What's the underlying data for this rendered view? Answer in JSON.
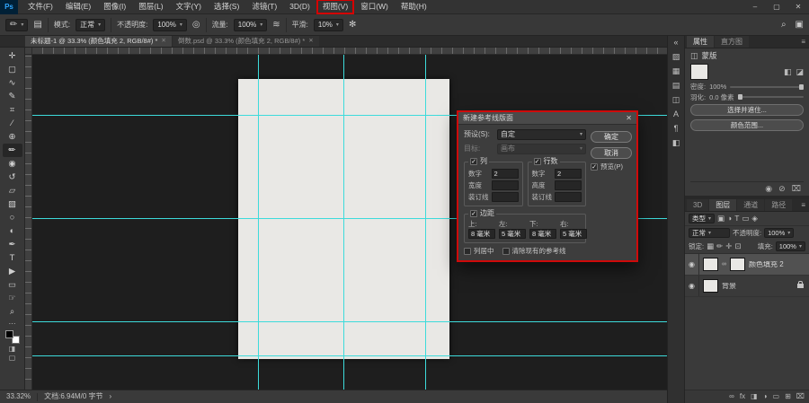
{
  "colors": {
    "annotation_red": "#d40000",
    "guide_cyan": "#3ddbdb",
    "ps_blue": "#31a8ff"
  },
  "icons": {
    "close": "✕",
    "minimize": "–",
    "maximize": "▢",
    "caret": "▾",
    "panel_menu": "≡",
    "collapse": "«",
    "search": "⌕",
    "workspace": "▣",
    "gear": "✻",
    "pressure": "◎",
    "airbrush": "≋",
    "brush_preset": "✏",
    "toggle_panel": "▤",
    "chevron": "›",
    "ellipsis": "⋯",
    "quick_mask": "◨",
    "screen_mode": "▢",
    "eye": "◉",
    "link": "∞",
    "fx": "fx",
    "add_mask": "◨",
    "adjustment": "◑",
    "group": "▭",
    "new_layer": "⊞",
    "trash": "⌧",
    "f_pixel": "▣",
    "f_adjust": "◑",
    "f_type": "T",
    "f_shape": "▭",
    "f_smart": "◈",
    "toggle": "●",
    "l_transparent": "▦",
    "l_brush": "✏",
    "l_move": "✛",
    "l_board": "⊡",
    "pixel_mask": "◧",
    "vector_mask": "◪",
    "invert": "⊘",
    "mask_head": "◫"
  },
  "titlebar": {
    "logo": "Ps",
    "menus": [
      "文件(F)",
      "编辑(E)",
      "图像(I)",
      "图层(L)",
      "文字(Y)",
      "选择(S)",
      "滤镜(T)",
      "3D(D)",
      "视图(V)",
      "窗口(W)",
      "帮助(H)"
    ],
    "highlighted_menu": "视图(V)"
  },
  "optionsbar": {
    "mode_label": "模式:",
    "mode_value": "正常",
    "opacity_label": "不透明度:",
    "opacity_value": "100%",
    "flow_label": "流量:",
    "flow_value": "100%",
    "smoothing_label": "平滑:",
    "smoothing_value": "10%"
  },
  "tabs": [
    {
      "label": "未标题-1 @ 33.3% (颜色填充 2, RGB/8#) *",
      "active": true
    },
    {
      "label": "倒数.psd @ 33.3% (颜色填充 2, RGB/8#) *",
      "active": false
    }
  ],
  "tools": [
    {
      "name": "move",
      "glyph": "✛"
    },
    {
      "name": "marquee",
      "glyph": "▢"
    },
    {
      "name": "lasso",
      "glyph": "∿"
    },
    {
      "name": "quick-select",
      "glyph": "✎"
    },
    {
      "name": "crop",
      "glyph": "⌗"
    },
    {
      "name": "eyedropper",
      "glyph": "∕"
    },
    {
      "name": "healing",
      "glyph": "⊕"
    },
    {
      "name": "brush",
      "glyph": "✏"
    },
    {
      "name": "clone-stamp",
      "glyph": "◉"
    },
    {
      "name": "history-brush",
      "glyph": "↺"
    },
    {
      "name": "eraser",
      "glyph": "▱"
    },
    {
      "name": "gradient",
      "glyph": "▧"
    },
    {
      "name": "blur",
      "glyph": "○"
    },
    {
      "name": "dodge",
      "glyph": "◐"
    },
    {
      "name": "pen",
      "glyph": "✒"
    },
    {
      "name": "type",
      "glyph": "T"
    },
    {
      "name": "path-select",
      "glyph": "▶"
    },
    {
      "name": "shape",
      "glyph": "▭"
    },
    {
      "name": "hand",
      "glyph": "☞"
    },
    {
      "name": "zoom",
      "glyph": "⌕"
    }
  ],
  "dock_icons": [
    {
      "name": "color",
      "glyph": "▨"
    },
    {
      "name": "swatches",
      "glyph": "▦"
    },
    {
      "name": "gradients",
      "glyph": "▤"
    },
    {
      "name": "patterns",
      "glyph": "◫"
    },
    {
      "name": "character",
      "glyph": "A"
    },
    {
      "name": "paragraph",
      "glyph": "¶"
    },
    {
      "name": "libraries",
      "glyph": "◧"
    }
  ],
  "dialog": {
    "title": "新建参考线版面",
    "preset_label": "预设(S):",
    "preset_value": "自定",
    "target_label": "目标:",
    "target_value": "画布",
    "ok": "确定",
    "cancel": "取消",
    "preview": "预览(P)",
    "columns_title": "列",
    "rows_title": "行数",
    "number_label": "数字",
    "columns_number": "2",
    "rows_number": "2",
    "width_label": "宽度",
    "columns_width": "",
    "height_label": "高度",
    "rows_height": "",
    "gutter_label": "装订线",
    "columns_gutter": "",
    "rows_gutter": "",
    "margin_title": "边距",
    "top_label": "上:",
    "left_label": "左:",
    "bottom_label": "下:",
    "right_label": "右:",
    "top_value": "8 毫米",
    "left_value": "5 毫米",
    "bottom_value": "8 毫米",
    "right_value": "5 毫米",
    "center_columns": "列居中",
    "clear_existing": "清除现有的参考线"
  },
  "properties_panel": {
    "tab_properties": "属性",
    "tab_histogram": "直方图",
    "header": "蒙版",
    "density_label": "密度:",
    "density_value": "100%",
    "feather_label": "羽化:",
    "feather_value": "0.0 像素",
    "button_select_mask": "选择并遮住...",
    "button_color_range": "颜色范围..."
  },
  "layers_panel": {
    "tab_3d": "3D",
    "tab_layers": "图层",
    "tab_channels": "通道",
    "tab_paths": "路径",
    "filter_label": "类型",
    "blend_mode": "正常",
    "opacity_label": "不透明度:",
    "opacity_value": "100%",
    "lock_label": "锁定:",
    "fill_label": "填充:",
    "fill_value": "100%",
    "layers": [
      {
        "name": "颜色填充 2",
        "selected": true,
        "has_mask": true
      },
      {
        "name": "背景",
        "selected": false,
        "locked": true
      }
    ]
  },
  "statusbar": {
    "zoom": "33.32%",
    "doc_info": "文档:6.94M/0 字节"
  }
}
